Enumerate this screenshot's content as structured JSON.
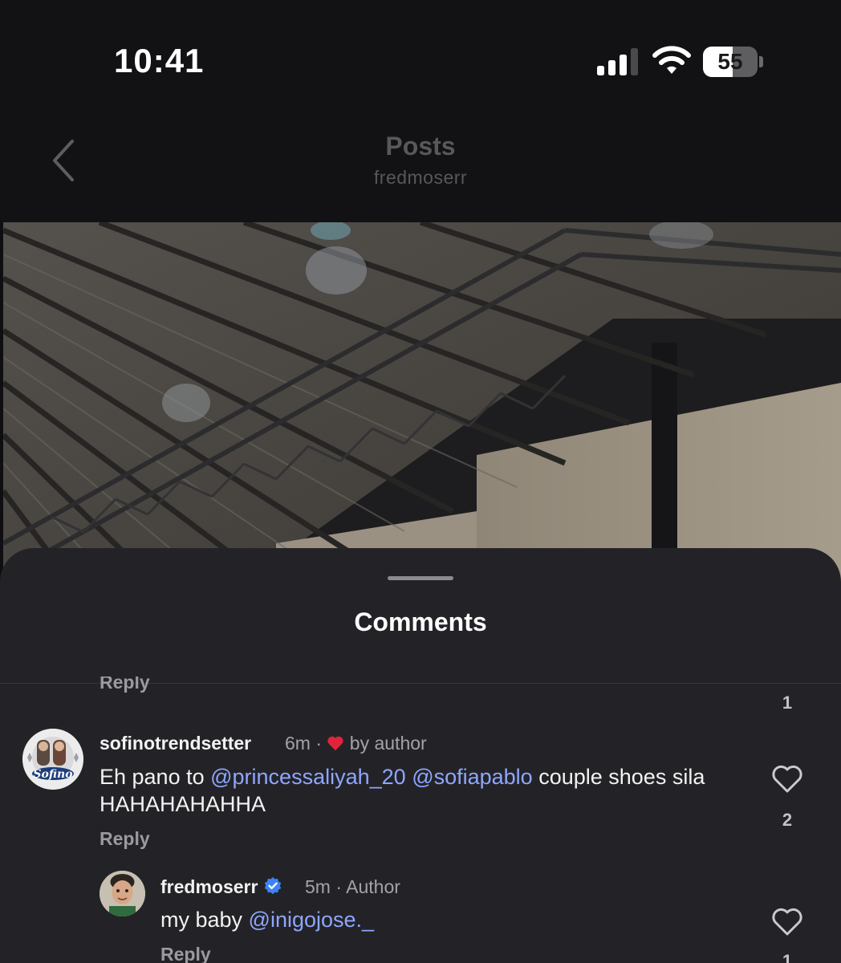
{
  "status_bar": {
    "time": "10:41",
    "battery_percent": "55",
    "battery_level": 0.55,
    "icons": [
      "signal-icon",
      "wifi-icon",
      "battery-icon"
    ]
  },
  "header": {
    "title": "Posts",
    "subtitle": "fredmoserr",
    "back_icon": "chevron-left-icon"
  },
  "sheet": {
    "title": "Comments"
  },
  "previous_comment": {
    "reply_label": "Reply",
    "like_count": "1"
  },
  "comments": [
    {
      "username": "sofinotrendsetter",
      "time": "6m",
      "separator": "·",
      "liked_by_author_label": "by author",
      "text_part1": "Eh pano to ",
      "mention1": "@princessaliyah_20",
      "text_part2": " ",
      "mention2": "@sofiapablo",
      "text_part3": " couple shoes sila HAHAHAHAHHA",
      "avatar_label": "Sofino",
      "reply_label": "Reply",
      "like_count": "2"
    },
    {
      "username": "fredmoserr",
      "time": "5m",
      "separator": "·",
      "author_label": "Author",
      "text_part1": "my baby ",
      "mention1": "@inigojose._",
      "reply_label": "Reply",
      "like_count": "1"
    }
  ],
  "colors": {
    "background": "#121214",
    "sheet": "#232327",
    "mention": "#8fa6ff",
    "heart": "#e0243a",
    "verified": "#3b82f6"
  }
}
